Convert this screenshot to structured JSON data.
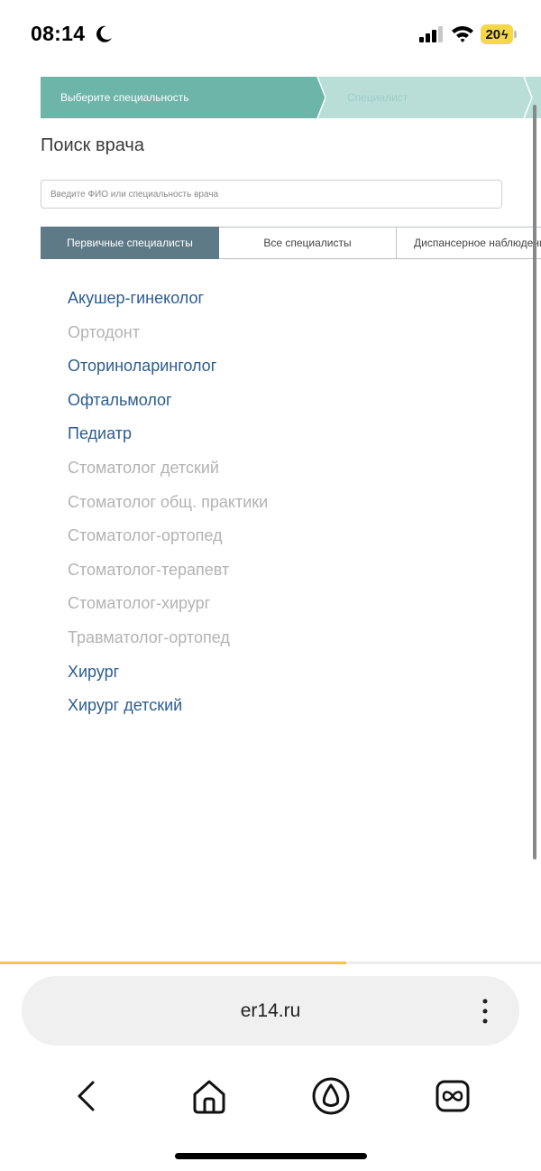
{
  "status_bar": {
    "time": "08:14",
    "battery": "20"
  },
  "steps": [
    {
      "label": "Выберите специальность",
      "active": true
    },
    {
      "label": "Специалист",
      "active": false
    }
  ],
  "page": {
    "title": "Поиск врача"
  },
  "search": {
    "placeholder": "Введите ФИО или специальность врача",
    "value": ""
  },
  "tabs": [
    {
      "label": "Первичные специалисты",
      "active": true
    },
    {
      "label": "Все специалисты",
      "active": false
    },
    {
      "label": "Диспансерное наблюдение",
      "active": false
    }
  ],
  "specialties": [
    {
      "name": "Акушер-гинеколог",
      "enabled": true
    },
    {
      "name": "Ортодонт",
      "enabled": false
    },
    {
      "name": "Оториноларинголог",
      "enabled": true
    },
    {
      "name": "Офтальмолог",
      "enabled": true
    },
    {
      "name": "Педиатр",
      "enabled": true
    },
    {
      "name": "Стоматолог детский",
      "enabled": false
    },
    {
      "name": "Стоматолог общ. практики",
      "enabled": false
    },
    {
      "name": "Стоматолог-ортопед",
      "enabled": false
    },
    {
      "name": "Стоматолог-терапевт",
      "enabled": false
    },
    {
      "name": "Стоматолог-хирург",
      "enabled": false
    },
    {
      "name": "Травматолог-ортопед",
      "enabled": false
    },
    {
      "name": "Хирург",
      "enabled": true
    },
    {
      "name": "Хирург детский",
      "enabled": true
    }
  ],
  "browser": {
    "url": "er14.ru",
    "load_progress": 0.64,
    "nav_icons": [
      "back-icon",
      "home-icon",
      "alice-icon",
      "tabs-icon"
    ]
  },
  "colors": {
    "step_active": "#6db5a8",
    "step_inactive": "#b9ded8",
    "tab_active": "#5f7a87",
    "link_enabled": "#2c5d8f",
    "link_disabled": "#b3b3b3",
    "progress": "#f5c34b",
    "battery": "#f5d84a"
  }
}
